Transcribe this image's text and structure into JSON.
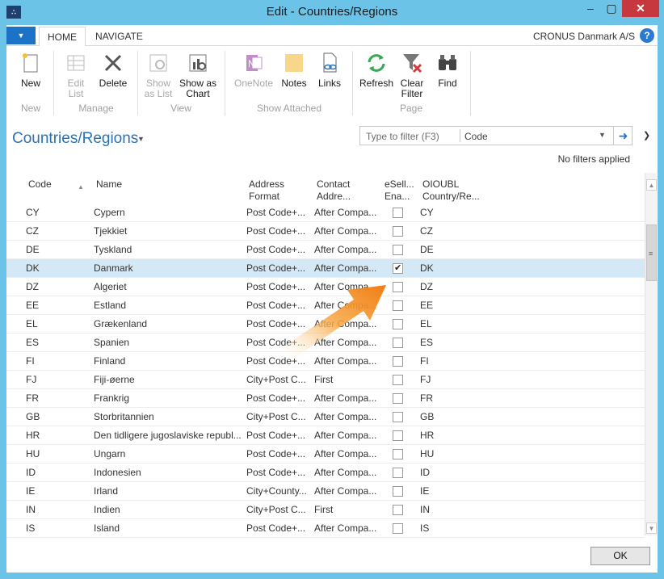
{
  "window": {
    "title": "Edit - Countries/Regions",
    "minimize": "–",
    "maximize": "▢",
    "close": "✕",
    "app_icon": "∴"
  },
  "ribbon_tabs": {
    "home": "HOME",
    "navigate": "NAVIGATE",
    "app_menu": "▼"
  },
  "company": "CRONUS Danmark A/S",
  "help": "?",
  "ribbon": {
    "new": "New",
    "edit_list": "Edit\nList",
    "delete": "Delete",
    "show_as_list": "Show\nas List",
    "show_as_chart": "Show as\nChart",
    "onenote": "OneNote",
    "notes": "Notes",
    "links": "Links",
    "refresh": "Refresh",
    "clear_filter": "Clear\nFilter",
    "find": "Find",
    "groups": {
      "new": "New",
      "manage": "Manage",
      "view": "View",
      "show_attached": "Show Attached",
      "page": "Page"
    }
  },
  "page_title": "Countries/Regions",
  "filter": {
    "placeholder": "Type to filter (F3)",
    "field": "Code",
    "status": "No filters applied"
  },
  "columns": {
    "code": "Code",
    "name": "Name",
    "address_format": "Address\nFormat",
    "contact_address": "Contact\nAddre...",
    "esell": "eSell...\nEna...",
    "oioubl": "OIOUBL\nCountry/Re..."
  },
  "rows": [
    {
      "code": "CY",
      "name": "Cypern",
      "addr": "Post Code+...",
      "contact": "After Compa...",
      "esell": false,
      "oioubl": "CY"
    },
    {
      "code": "CZ",
      "name": "Tjekkiet",
      "addr": "Post Code+...",
      "contact": "After Compa...",
      "esell": false,
      "oioubl": "CZ"
    },
    {
      "code": "DE",
      "name": "Tyskland",
      "addr": "Post Code+...",
      "contact": "After Compa...",
      "esell": false,
      "oioubl": "DE"
    },
    {
      "code": "DK",
      "name": "Danmark",
      "addr": "Post Code+...",
      "contact": "After Compa...",
      "esell": true,
      "oioubl": "DK",
      "selected": true
    },
    {
      "code": "DZ",
      "name": "Algeriet",
      "addr": "Post Code+...",
      "contact": "After Compa...",
      "esell": false,
      "oioubl": "DZ"
    },
    {
      "code": "EE",
      "name": "Estland",
      "addr": "Post Code+...",
      "contact": "After Compa...",
      "esell": false,
      "oioubl": "EE"
    },
    {
      "code": "EL",
      "name": "Grækenland",
      "addr": "Post Code+...",
      "contact": "After Compa...",
      "esell": false,
      "oioubl": "EL"
    },
    {
      "code": "ES",
      "name": "Spanien",
      "addr": "Post Code+...",
      "contact": "After Compa...",
      "esell": false,
      "oioubl": "ES"
    },
    {
      "code": "FI",
      "name": "Finland",
      "addr": "Post Code+...",
      "contact": "After Compa...",
      "esell": false,
      "oioubl": "FI"
    },
    {
      "code": "FJ",
      "name": "Fiji-øerne",
      "addr": "City+Post C...",
      "contact": "First",
      "esell": false,
      "oioubl": "FJ"
    },
    {
      "code": "FR",
      "name": "Frankrig",
      "addr": "Post Code+...",
      "contact": "After Compa...",
      "esell": false,
      "oioubl": "FR"
    },
    {
      "code": "GB",
      "name": "Storbritannien",
      "addr": "City+Post C...",
      "contact": "After Compa...",
      "esell": false,
      "oioubl": "GB"
    },
    {
      "code": "HR",
      "name": "Den tidligere jugoslaviske republ...",
      "addr": "Post Code+...",
      "contact": "After Compa...",
      "esell": false,
      "oioubl": "HR"
    },
    {
      "code": "HU",
      "name": "Ungarn",
      "addr": "Post Code+...",
      "contact": "After Compa...",
      "esell": false,
      "oioubl": "HU"
    },
    {
      "code": "ID",
      "name": "Indonesien",
      "addr": "Post Code+...",
      "contact": "After Compa...",
      "esell": false,
      "oioubl": "ID"
    },
    {
      "code": "IE",
      "name": "Irland",
      "addr": "City+County...",
      "contact": "After Compa...",
      "esell": false,
      "oioubl": "IE"
    },
    {
      "code": "IN",
      "name": "Indien",
      "addr": "City+Post C...",
      "contact": "First",
      "esell": false,
      "oioubl": "IN"
    },
    {
      "code": "IS",
      "name": "Island",
      "addr": "Post Code+...",
      "contact": "After Compa...",
      "esell": false,
      "oioubl": "IS"
    }
  ],
  "ok_button": "OK",
  "colors": {
    "title_bar": "#6cc3e8",
    "accent": "#2a72b5",
    "selected_row": "#d5e8f5",
    "close": "#c7383e",
    "arrow": "#f7941d"
  },
  "icons": {
    "new": "new-icon",
    "edit_list": "edit-list-icon",
    "delete": "delete-icon",
    "show_as_list": "show-as-list-icon",
    "show_as_chart": "chart-icon",
    "onenote": "onenote-icon",
    "notes": "notes-icon",
    "links": "links-icon",
    "refresh": "refresh-icon",
    "clear_filter": "clear-filter-icon",
    "find": "binoculars-icon"
  }
}
